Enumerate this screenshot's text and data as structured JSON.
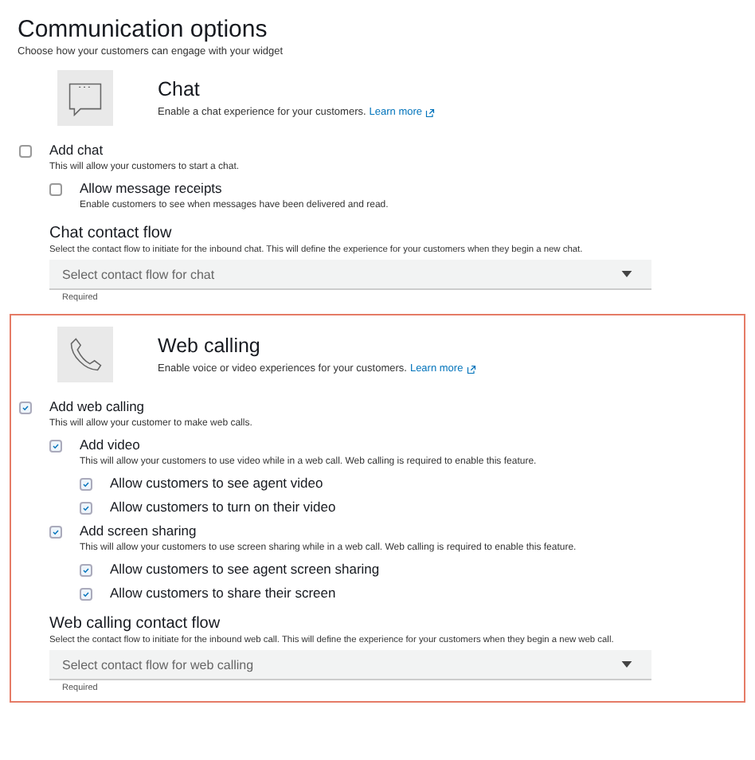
{
  "title": "Communication options",
  "subtitle": "Choose how your customers can engage with your widget",
  "sections": [
    {
      "kind": "chat",
      "highlighted": false,
      "title": "Chat",
      "description": "Enable a chat experience for your customers.",
      "link": "Learn more",
      "options": [
        {
          "label": "Add chat",
          "description": "This will allow your customers to start a chat.",
          "checked": false,
          "children": [
            {
              "label": "Allow message receipts",
              "description": "Enable customers to see when messages have been delivered and read.",
              "checked": false
            }
          ]
        }
      ],
      "flow": {
        "label": "Chat contact flow",
        "description": "Select the contact flow to initiate for the inbound chat. This will define the experience for your customers when they begin a new chat.",
        "placeholder": "Select contact flow for chat",
        "hint": "Required"
      }
    },
    {
      "kind": "phone",
      "highlighted": true,
      "title": "Web calling",
      "description": "Enable voice or video experiences for your customers.",
      "link": "Learn more",
      "options": [
        {
          "label": "Add web calling",
          "description": "This will allow your customer to make web calls.",
          "checked": true,
          "children": [
            {
              "label": "Add video",
              "description": "This will allow your customers to use video while in a web call. Web calling is required to enable this feature.",
              "checked": true,
              "children": [
                {
                  "label": "Allow customers to see agent video",
                  "checked": true
                },
                {
                  "label": "Allow customers to turn on their video",
                  "checked": true
                }
              ]
            },
            {
              "label": "Add screen sharing",
              "description": "This will allow your customers to use screen sharing while in a web call. Web calling is required to enable this feature.",
              "checked": true,
              "children": [
                {
                  "label": "Allow customers to see agent screen sharing",
                  "checked": true
                },
                {
                  "label": "Allow customers to share their screen",
                  "checked": true
                }
              ]
            }
          ]
        }
      ],
      "flow": {
        "label": "Web calling contact flow",
        "description": "Select the contact flow to initiate for the inbound web call. This will define the experience for your customers when they begin a new web call.",
        "placeholder": "Select contact flow for web calling",
        "hint": "Required"
      }
    }
  ]
}
